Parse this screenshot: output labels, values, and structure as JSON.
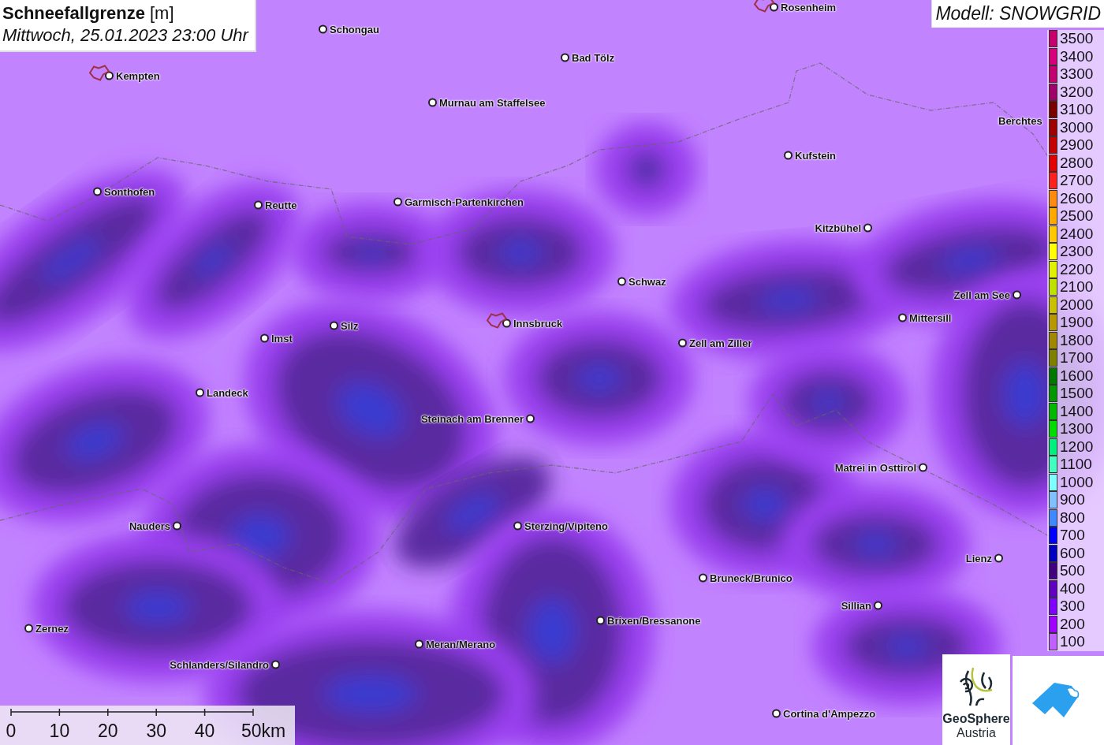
{
  "title": {
    "parameter": "Schneefallgrenze",
    "unit": "[m]",
    "datetime": "Mittwoch, 25.01.2023 23:00 Uhr"
  },
  "model": "Modell: SNOWGRID",
  "cities": [
    {
      "name": "Schongau",
      "outlined": false
    },
    {
      "name": "Rosenheim",
      "outlined": true
    },
    {
      "name": "Bad Tölz",
      "outlined": false
    },
    {
      "name": "Kempten",
      "outlined": true
    },
    {
      "name": "Murnau am Staffelsee",
      "outlined": false
    },
    {
      "name": "Berchtes",
      "outlined": false
    },
    {
      "name": "Kufstein",
      "outlined": false
    },
    {
      "name": "Sonthofen",
      "outlined": false
    },
    {
      "name": "Reutte",
      "outlined": false
    },
    {
      "name": "Garmisch-Partenkirchen",
      "outlined": false
    },
    {
      "name": "Kitzbühel",
      "outlined": false
    },
    {
      "name": "Schwaz",
      "outlined": false
    },
    {
      "name": "Zell am See",
      "outlined": false
    },
    {
      "name": "Mittersill",
      "outlined": false
    },
    {
      "name": "Innsbruck",
      "outlined": true
    },
    {
      "name": "Silz",
      "outlined": false
    },
    {
      "name": "Imst",
      "outlined": false
    },
    {
      "name": "Zell am Ziller",
      "outlined": false
    },
    {
      "name": "Landeck",
      "outlined": false
    },
    {
      "name": "Steinach am Brenner",
      "outlined": false
    },
    {
      "name": "Matrei in Osttirol",
      "outlined": false
    },
    {
      "name": "Nauders",
      "outlined": false
    },
    {
      "name": "Sterzing/Vipiteno",
      "outlined": false
    },
    {
      "name": "Lienz",
      "outlined": false
    },
    {
      "name": "Bruneck/Brunico",
      "outlined": false
    },
    {
      "name": "Sillian",
      "outlined": false
    },
    {
      "name": "Brixen/Bressanone",
      "outlined": false
    },
    {
      "name": "Zernez",
      "outlined": false
    },
    {
      "name": "Meran/Merano",
      "outlined": false
    },
    {
      "name": "Schlanders/Silandro",
      "outlined": false
    },
    {
      "name": "Cortina d'Ampezzo",
      "outlined": false
    }
  ],
  "legend": [
    {
      "label": "3500",
      "color": "#c8006e"
    },
    {
      "label": "3400",
      "color": "#d8007a"
    },
    {
      "label": "3300",
      "color": "#c40070"
    },
    {
      "label": "3200",
      "color": "#a0006a"
    },
    {
      "label": "3100",
      "color": "#7a0000"
    },
    {
      "label": "3000",
      "color": "#a00000"
    },
    {
      "label": "2900",
      "color": "#c40000"
    },
    {
      "label": "2800",
      "color": "#e40000"
    },
    {
      "label": "2700",
      "color": "#ff2020"
    },
    {
      "label": "2600",
      "color": "#ff8a10"
    },
    {
      "label": "2500",
      "color": "#ffa800"
    },
    {
      "label": "2400",
      "color": "#ffc800"
    },
    {
      "label": "2300",
      "color": "#ffff00"
    },
    {
      "label": "2200",
      "color": "#e0f000"
    },
    {
      "label": "2100",
      "color": "#c0e000"
    },
    {
      "label": "2000",
      "color": "#c8c000"
    },
    {
      "label": "1900",
      "color": "#b89800"
    },
    {
      "label": "1800",
      "color": "#a08800"
    },
    {
      "label": "1700",
      "color": "#808000"
    },
    {
      "label": "1600",
      "color": "#007800"
    },
    {
      "label": "1500",
      "color": "#009800"
    },
    {
      "label": "1400",
      "color": "#00b800"
    },
    {
      "label": "1300",
      "color": "#00dc00"
    },
    {
      "label": "1200",
      "color": "#00f080"
    },
    {
      "label": "1100",
      "color": "#40ffc0"
    },
    {
      "label": "1000",
      "color": "#80ffff"
    },
    {
      "label": "900",
      "color": "#80c0ff"
    },
    {
      "label": "800",
      "color": "#4088ff"
    },
    {
      "label": "700",
      "color": "#0000ff"
    },
    {
      "label": "600",
      "color": "#0000c0"
    },
    {
      "label": "500",
      "color": "#400080"
    },
    {
      "label": "400",
      "color": "#6000c0"
    },
    {
      "label": "300",
      "color": "#8000ff"
    },
    {
      "label": "200",
      "color": "#a000ff"
    },
    {
      "label": "100",
      "color": "#c060ff"
    }
  ],
  "scale": [
    "0",
    "10",
    "20",
    "30",
    "40",
    "50km"
  ],
  "logo": {
    "name": "GeoSphere",
    "subtitle": "Austria"
  }
}
